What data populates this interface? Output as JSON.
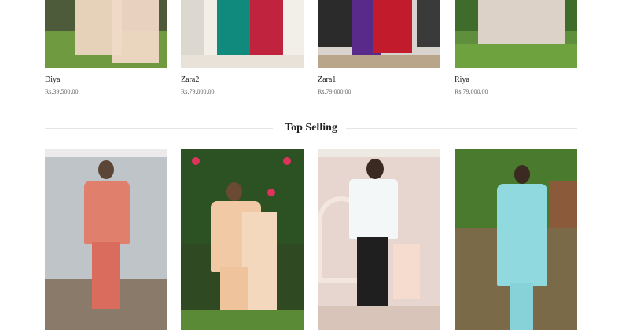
{
  "top_row": [
    {
      "name": "Diya",
      "price": "Rs.39,500.00"
    },
    {
      "name": "Zara2",
      "price": "Rs.79,000.00"
    },
    {
      "name": "Zara1",
      "price": "Rs.79,000.00"
    },
    {
      "name": "Riya",
      "price": "Rs.79,000.00"
    }
  ],
  "section": {
    "title": "Top Selling"
  },
  "bottom_row": [
    {
      "image": "model-pink-outfit"
    },
    {
      "image": "model-peach-outfit-flowers"
    },
    {
      "image": "model-white-shirt-black-trousers"
    },
    {
      "image": "model-aqua-outfit-garden"
    }
  ]
}
